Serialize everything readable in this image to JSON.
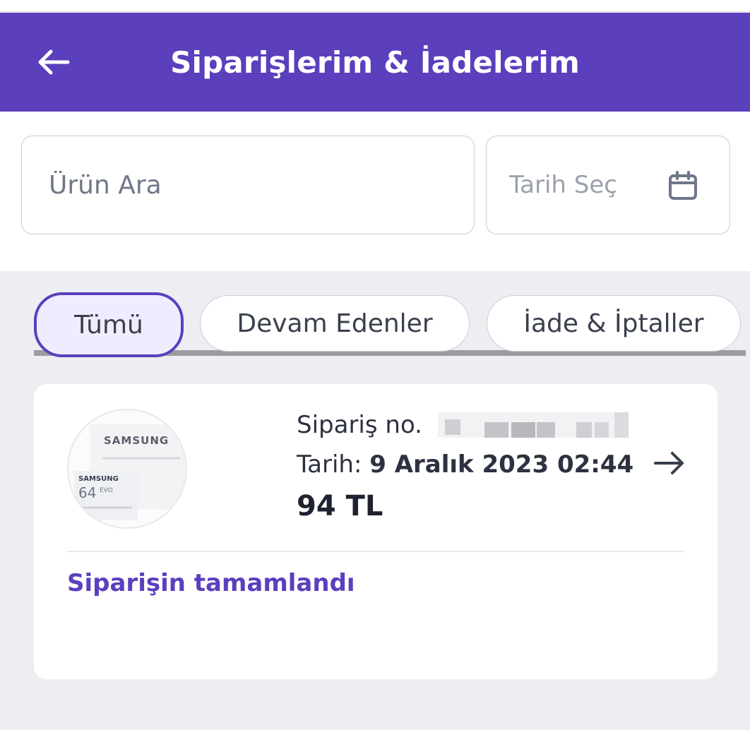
{
  "header": {
    "title": "Siparişlerim & İadelerim"
  },
  "search": {
    "placeholder": "Ürün Ara",
    "value": ""
  },
  "date_filter": {
    "label": "Tarih Seç"
  },
  "tabs": [
    {
      "label": "Tümü",
      "active": true
    },
    {
      "label": "Devam Edenler",
      "active": false
    },
    {
      "label": "İade & İptaller",
      "active": false
    }
  ],
  "order": {
    "number_label": "Sipariş no.",
    "date_label": "Tarih:",
    "date_value": "9 Aralık 2023 02:44",
    "price": "94 TL",
    "status": "Siparişin tamamlandı",
    "product_image_texts": {
      "brand": "SAMSUNG",
      "capacity": "64",
      "line": "EVO"
    }
  },
  "colors": {
    "primary": "#5b3fbd",
    "background": "#edeef2",
    "card": "#ffffff"
  }
}
